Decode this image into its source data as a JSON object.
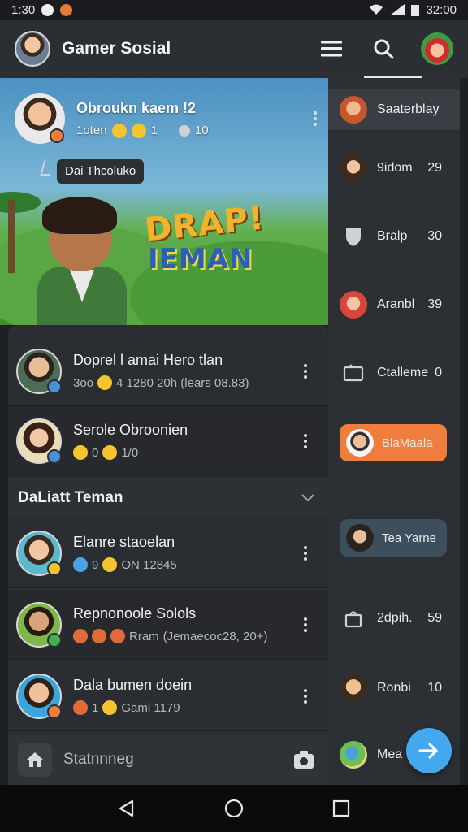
{
  "status_bar": {
    "time_left": "1:30",
    "time_right": "32:00"
  },
  "app": {
    "title": "Gamer Sosial"
  },
  "post": {
    "title": "Obroukn kaem !2",
    "sub_text": "1oten",
    "count_a": "1",
    "count_b": "10",
    "tooltip": "Dai Thcoluko",
    "logo_line1": "DRAP!",
    "logo_line2": "IEMAN"
  },
  "chats_top": [
    {
      "name": "Doprel l amai Hero tlan",
      "preview": "3oo",
      "preview_tail": "4 1280 20h (lears 08.83)",
      "badge_color": "#4a90d9"
    },
    {
      "name": "Serole Obroonien",
      "preview": "0",
      "preview_tail": "1/0",
      "badge_color": "#4a90d9"
    }
  ],
  "section": {
    "title": "DaLiatt Teman"
  },
  "chats_bottom": [
    {
      "name": "Elanre staoelan",
      "preview": "9",
      "preview_tail": "ON     12845",
      "badge_color": "#f2c531"
    },
    {
      "name": "Repnonoole Solols",
      "preview": "Rram",
      "preview_tail": "(Jemaecoc28, 20+)",
      "badge_color": "#44b04a"
    },
    {
      "name": "Dala bumen doein",
      "preview": "1",
      "preview_tail": "Gaml 1179",
      "badge_color": "#ef7d3c"
    }
  ],
  "composer": {
    "placeholder": "Statnnneg"
  },
  "rail": {
    "items": [
      {
        "label": "Saaterblay",
        "count": ""
      },
      {
        "label": "9idom",
        "count": "29"
      },
      {
        "label": "Bralp",
        "count": "30"
      },
      {
        "label": "Aranbl",
        "count": "39"
      },
      {
        "label": "Ctalleme",
        "count": "0"
      },
      {
        "label": "BlaMaala",
        "count": ""
      },
      {
        "label": "Tea Yarne",
        "count": ""
      },
      {
        "label": "2dpih.",
        "count": "59"
      },
      {
        "label": "Ronbi",
        "count": "10"
      },
      {
        "label": "Mea",
        "count": ""
      }
    ]
  },
  "colors": {
    "accent_blue": "#43a8ee",
    "highlight_orange": "#ef7d3c",
    "panel": "#2a2d31",
    "appbar": "#2b2e33"
  },
  "icons": [
    "menu-icon",
    "search-icon",
    "home-icon",
    "camera-icon",
    "send-icon",
    "back-icon",
    "home-nav-icon",
    "recents-icon",
    "chevron-down-icon"
  ]
}
